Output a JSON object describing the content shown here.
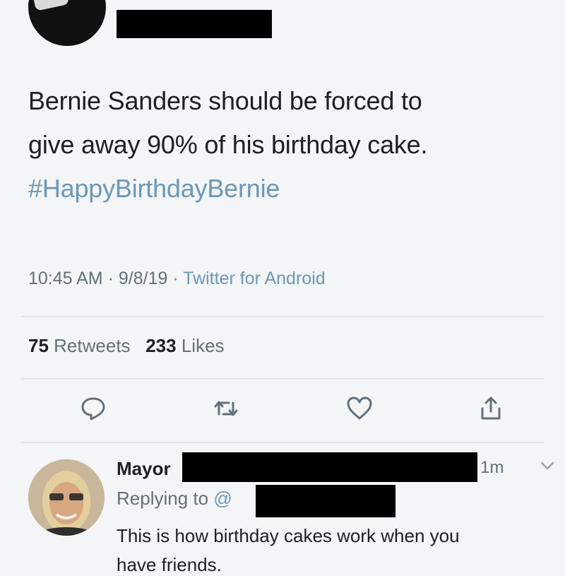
{
  "tweet": {
    "text_line1": "Bernie Sanders should be forced to",
    "text_line2": "give away 90% of his birthday cake.",
    "hashtag": "#HappyBirthdayBernie",
    "time": "10:45 AM",
    "date": "9/8/19",
    "source": "Twitter for Android",
    "retweets_count": "75",
    "retweets_label": "Retweets",
    "likes_count": "233",
    "likes_label": "Likes"
  },
  "actions": {
    "reply_icon": "reply-icon",
    "retweet_icon": "retweet-icon",
    "like_icon": "heart-icon",
    "share_icon": "share-icon"
  },
  "reply": {
    "name": "Mayor",
    "time": "1m",
    "replying_prefix": "Replying to",
    "replying_handle": "@",
    "text": "This is how birthday cakes work when you",
    "text_cut": "have friends."
  },
  "colors": {
    "link": "#6a98b8",
    "text": "#1c2022",
    "muted": "#62707a",
    "background": "#f4f5f6"
  }
}
